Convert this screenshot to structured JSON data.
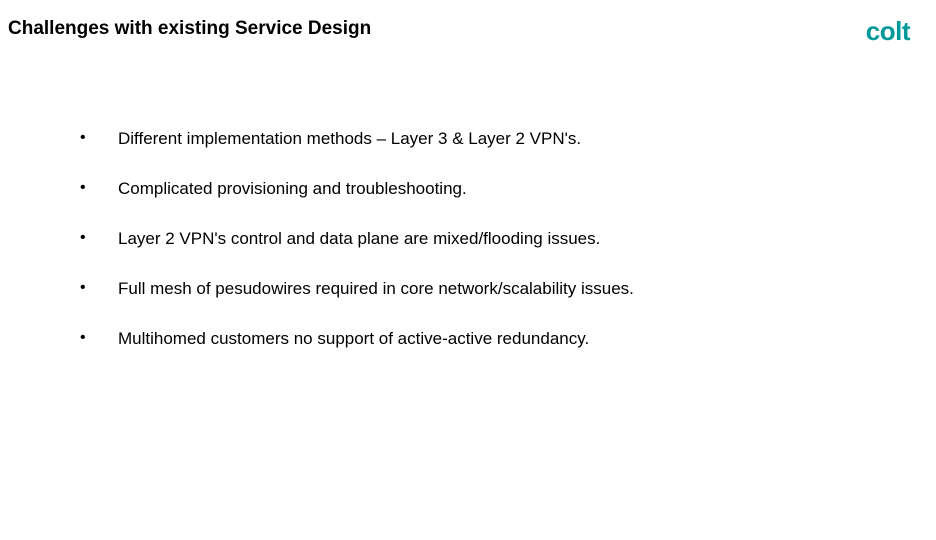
{
  "title": "Challenges with existing Service Design",
  "logo_text": "colt",
  "bullets": [
    "Different implementation methods – Layer 3 & Layer 2 VPN's.",
    "Complicated provisioning and troubleshooting.",
    "Layer 2 VPN's control and data plane are mixed/flooding issues.",
    "Full mesh of pesudowires required in core network/scalability issues.",
    "Multihomed customers no support of active-active redundancy."
  ]
}
